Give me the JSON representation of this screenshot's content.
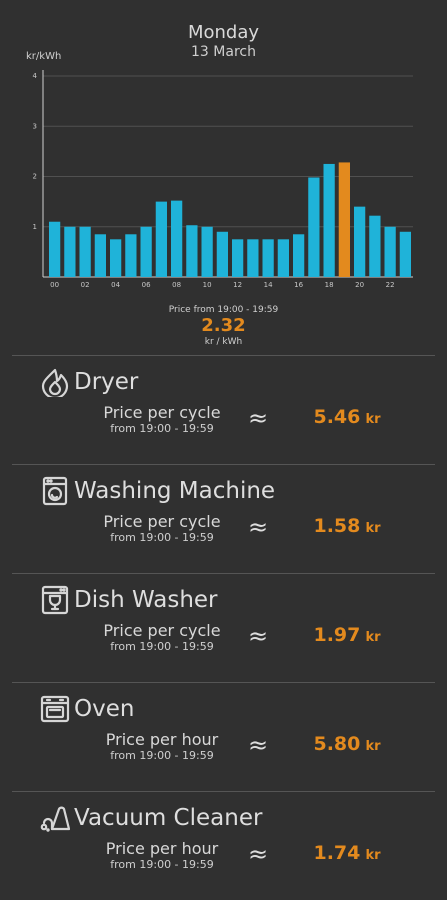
{
  "header": {
    "day": "Monday",
    "date": "13 March"
  },
  "chart_data": {
    "type": "bar",
    "ylabel": "kr/kWh",
    "ylim": [
      0,
      4
    ],
    "yticks": [
      "1",
      "2",
      "3",
      "4"
    ],
    "grid": true,
    "x_tick_labels": [
      "00",
      "02",
      "04",
      "06",
      "08",
      "10",
      "12",
      "14",
      "16",
      "18",
      "20",
      "22"
    ],
    "categories": [
      "00",
      "01",
      "02",
      "03",
      "04",
      "05",
      "06",
      "07",
      "08",
      "09",
      "10",
      "11",
      "12",
      "13",
      "14",
      "15",
      "16",
      "17",
      "18",
      "19",
      "20",
      "21",
      "22",
      "23"
    ],
    "values": [
      1.1,
      1.0,
      1.0,
      0.85,
      0.75,
      0.85,
      1.0,
      1.5,
      1.52,
      1.03,
      1.0,
      0.9,
      0.75,
      0.75,
      0.75,
      0.75,
      0.85,
      1.98,
      2.25,
      2.28,
      1.4,
      1.22,
      1.0,
      0.9
    ],
    "highlight_index": 19,
    "bar_color": "#1fb3d9",
    "highlight_color": "#e38a1e"
  },
  "current_price": {
    "label": "Price from 19:00 - 19:59",
    "value": "2.32",
    "unit": "kr / kWh"
  },
  "appliances": [
    {
      "name": "Dryer",
      "icon": "dryer-icon",
      "per_label": "Price per cycle",
      "from_label": "from 19:00 - 19:59",
      "approx": "≈",
      "cost": "5.46",
      "unit": "kr"
    },
    {
      "name": "Washing Machine",
      "icon": "washing-machine-icon",
      "per_label": "Price per cycle",
      "from_label": "from 19:00 - 19:59",
      "approx": "≈",
      "cost": "1.58",
      "unit": "kr"
    },
    {
      "name": "Dish Washer",
      "icon": "dish-washer-icon",
      "per_label": "Price per cycle",
      "from_label": "from 19:00 - 19:59",
      "approx": "≈",
      "cost": "1.97",
      "unit": "kr"
    },
    {
      "name": "Oven",
      "icon": "oven-icon",
      "per_label": "Price per hour",
      "from_label": "from 19:00 - 19:59",
      "approx": "≈",
      "cost": "5.80",
      "unit": "kr"
    },
    {
      "name": "Vacuum Cleaner",
      "icon": "vacuum-cleaner-icon",
      "per_label": "Price per hour",
      "from_label": "from 19:00 - 19:59",
      "approx": "≈",
      "cost": "1.74",
      "unit": "kr"
    }
  ]
}
